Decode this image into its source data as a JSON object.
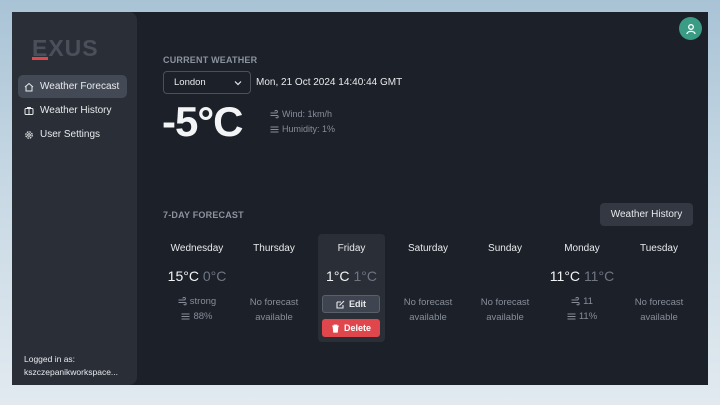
{
  "brand": {
    "logo_text": "EXUS"
  },
  "sidebar": {
    "items": [
      {
        "label": "Weather Forecast",
        "icon": "home-icon",
        "active": true
      },
      {
        "label": "Weather History",
        "icon": "history-icon",
        "active": false
      },
      {
        "label": "User Settings",
        "icon": "gear-icon",
        "active": false
      }
    ],
    "login_label": "Logged in as:",
    "login_user": "kszczepanikworkspace..."
  },
  "header": {
    "avatar_icon": "user-icon"
  },
  "current": {
    "section_title": "CURRENT WEATHER",
    "city": "London",
    "datetime": "Mon, 21 Oct 2024 14:40:44 GMT",
    "temperature": "-5°C",
    "wind": "Wind: 1km/h",
    "humidity": "Humidity: 1%"
  },
  "forecast": {
    "section_title": "7-DAY FORECAST",
    "history_button": "Weather History",
    "no_forecast_text": [
      "No forecast",
      "available"
    ],
    "edit_label": "Edit",
    "delete_label": "Delete",
    "days": [
      {
        "name": "Wednesday",
        "high": "15°C",
        "low": "0°C",
        "wind": "strong",
        "humidity": "88%"
      },
      {
        "name": "Thursday"
      },
      {
        "name": "Friday",
        "high": "1°C",
        "low": "1°C",
        "selected": true
      },
      {
        "name": "Saturday"
      },
      {
        "name": "Sunday"
      },
      {
        "name": "Monday",
        "high": "11°C",
        "low": "11°C",
        "wind": "11",
        "humidity": "11%"
      },
      {
        "name": "Tuesday"
      }
    ]
  },
  "colors": {
    "accent_red": "#e0474c",
    "avatar_green": "#3b9c86",
    "panel": "#1c2028",
    "sidebar": "#2a2e37"
  }
}
